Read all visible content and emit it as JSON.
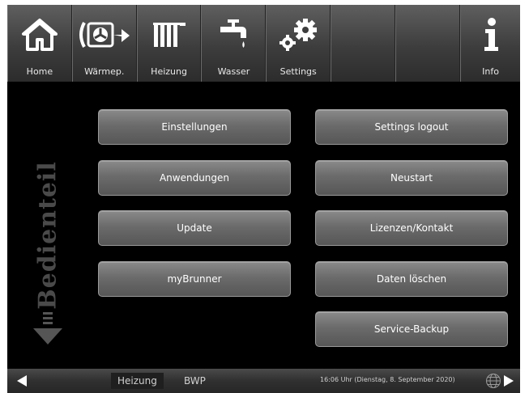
{
  "nav": {
    "items": [
      {
        "label": "Home",
        "icon": "home-icon"
      },
      {
        "label": "Wärmep.",
        "icon": "heat-pump-icon"
      },
      {
        "label": "Heizung",
        "icon": "radiator-icon"
      },
      {
        "label": "Wasser",
        "icon": "faucet-icon"
      },
      {
        "label": "Settings",
        "icon": "gears-icon"
      }
    ],
    "info": {
      "label": "Info",
      "icon": "info-icon"
    }
  },
  "side_label": "Bedienteil",
  "buttons_left": [
    "Einstellungen",
    "Anwendungen",
    "Update",
    "myBrunner"
  ],
  "buttons_right": [
    "Settings logout",
    "Neustart",
    "Lizenzen/Kontakt",
    "Daten löschen",
    "Service-Backup"
  ],
  "bottom": {
    "tabs": [
      "Heizung",
      "BWP"
    ],
    "datetime": "16:06 Uhr (Dienstag, 8. September 2020)"
  }
}
